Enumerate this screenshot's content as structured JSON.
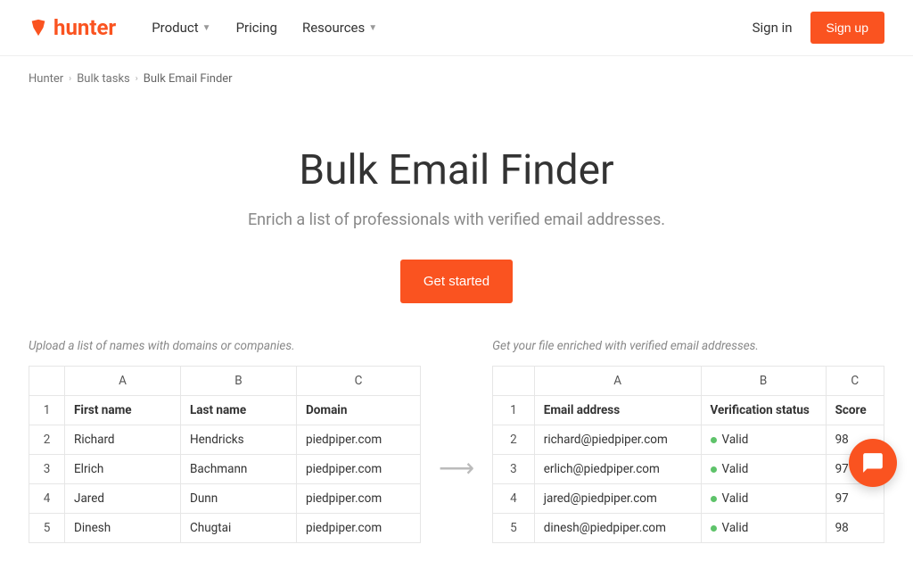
{
  "header": {
    "brand": "hunter",
    "nav": {
      "product": "Product",
      "pricing": "Pricing",
      "resources": "Resources"
    },
    "signin": "Sign in",
    "signup": "Sign up"
  },
  "breadcrumb": {
    "l0": "Hunter",
    "l1": "Bulk tasks",
    "l2": "Bulk Email Finder"
  },
  "hero": {
    "title": "Bulk Email Finder",
    "subtitle": "Enrich a list of professionals with verified email addresses.",
    "cta": "Get started"
  },
  "left_table": {
    "caption": "Upload a list of names with domains or companies.",
    "cols": [
      "A",
      "B",
      "C"
    ],
    "heads": {
      "a": "First name",
      "b": "Last name",
      "c": "Domain"
    },
    "rows": [
      {
        "n": "1"
      },
      {
        "n": "2",
        "a": "Richard",
        "b": "Hendricks",
        "c": "piedpiper.com"
      },
      {
        "n": "3",
        "a": "Elrich",
        "b": "Bachmann",
        "c": "piedpiper.com"
      },
      {
        "n": "4",
        "a": "Jared",
        "b": "Dunn",
        "c": "piedpiper.com"
      },
      {
        "n": "5",
        "a": "Dinesh",
        "b": "Chugtai",
        "c": "piedpiper.com"
      }
    ]
  },
  "right_table": {
    "caption": "Get your file enriched with verified email addresses.",
    "cols": [
      "A",
      "B",
      "C"
    ],
    "heads": {
      "a": "Email address",
      "b": "Verification status",
      "c": "Score"
    },
    "rows": [
      {
        "n": "1"
      },
      {
        "n": "2",
        "a": "richard@piedpiper.com",
        "b": "Valid",
        "c": "98"
      },
      {
        "n": "3",
        "a": "erlich@piedpiper.com",
        "b": "Valid",
        "c": "97"
      },
      {
        "n": "4",
        "a": "jared@piedpiper.com",
        "b": "Valid",
        "c": "97"
      },
      {
        "n": "5",
        "a": "dinesh@piedpiper.com",
        "b": "Valid",
        "c": "98"
      }
    ]
  },
  "colors": {
    "accent": "#fa5320",
    "valid": "#5ec36a"
  }
}
